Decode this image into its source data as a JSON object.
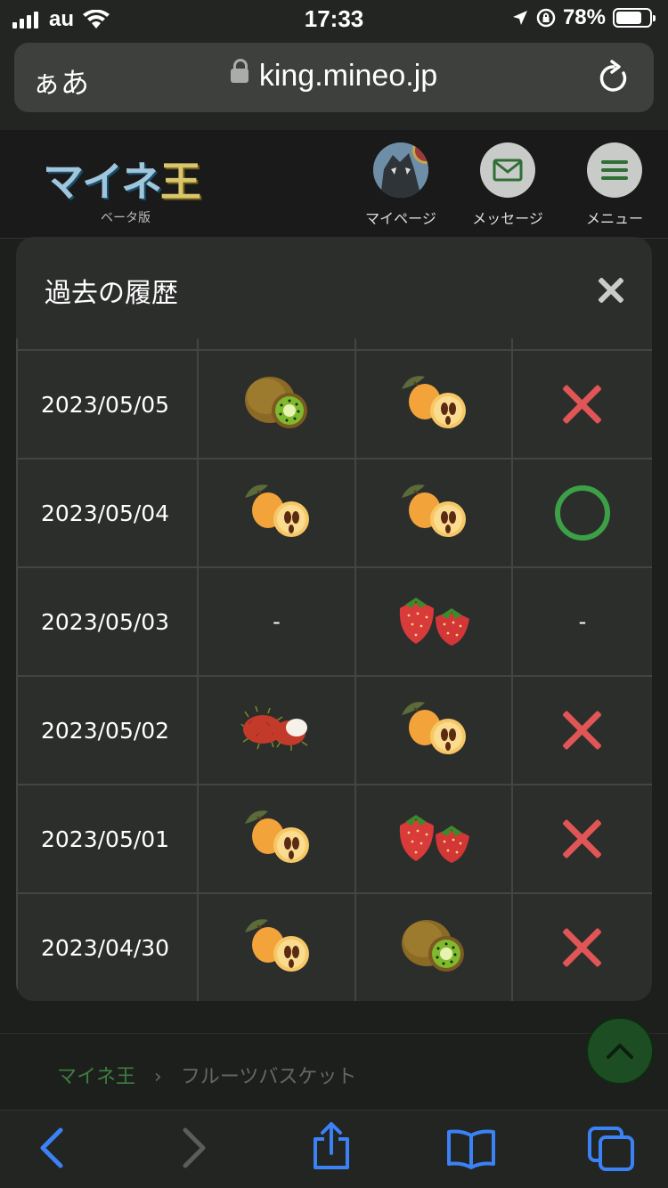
{
  "status": {
    "carrier": "au",
    "time": "17:33",
    "battery_percent": "78%",
    "battery_level": 0.78
  },
  "browser": {
    "aa_label": "ぁあ",
    "url": "king.mineo.jp"
  },
  "site": {
    "logo_text_a": "マイネ",
    "logo_text_b": "王",
    "logo_sub": "ベータ版",
    "nav": {
      "mypage": "マイページ",
      "mypage_badge": "!",
      "message": "メッセージ",
      "menu": "メニュー"
    }
  },
  "modal": {
    "title": "過去の履歴",
    "rows": [
      {
        "date": "2023/05/05",
        "col1": "kiwi-icon",
        "col2": "loquat-icon",
        "result": "x"
      },
      {
        "date": "2023/05/04",
        "col1": "loquat-icon",
        "col2": "loquat-icon",
        "result": "o"
      },
      {
        "date": "2023/05/03",
        "col1_text": "-",
        "col2": "strawberry-icon",
        "result_text": "-"
      },
      {
        "date": "2023/05/02",
        "col1": "rambutan-icon",
        "col2": "loquat-icon",
        "result": "x"
      },
      {
        "date": "2023/05/01",
        "col1": "loquat-icon",
        "col2": "strawberry-icon",
        "result": "x"
      },
      {
        "date": "2023/04/30",
        "col1": "loquat-icon",
        "col2": "kiwi-icon",
        "result": "x"
      }
    ]
  },
  "breadcrumb": {
    "home": "マイネ王",
    "separator": "›",
    "current": "フルーツバスケット"
  },
  "colors": {
    "x_mark": "#e05555",
    "o_mark": "#3ca146",
    "accent": "#3e7e3e"
  }
}
